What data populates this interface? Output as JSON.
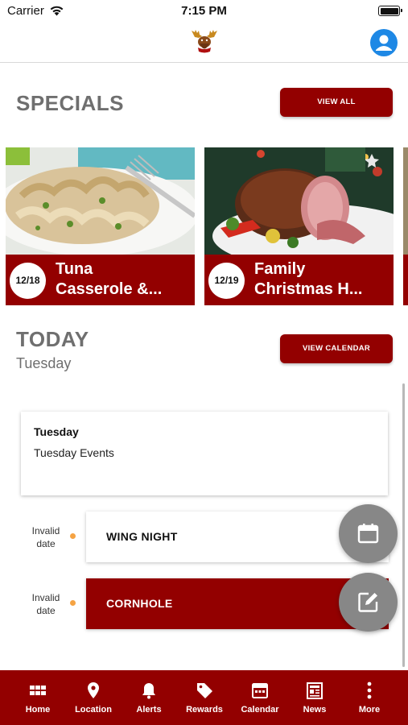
{
  "status_bar": {
    "carrier": "Carrier",
    "time": "7:15 PM"
  },
  "specials": {
    "heading": "SPECIALS",
    "view_all_label": "VIEW ALL",
    "items": [
      {
        "date": "12/18",
        "title_line1": "Tuna",
        "title_line2": "Casserole &..."
      },
      {
        "date": "12/19",
        "title_line1": "Family",
        "title_line2": "Christmas H..."
      }
    ]
  },
  "today": {
    "heading": "TODAY",
    "day": "Tuesday",
    "view_calendar_label": "VIEW CALENDAR",
    "card": {
      "day": "Tuesday",
      "text": "Tuesday Events"
    },
    "events": [
      {
        "date_line1": "Invalid",
        "date_line2": "date",
        "name": "WING NIGHT"
      },
      {
        "date_line1": "Invalid",
        "date_line2": "date",
        "name": "CORNHOLE"
      }
    ]
  },
  "tab_bar": {
    "items": [
      {
        "label": "Home",
        "icon": "grid-icon"
      },
      {
        "label": "Location",
        "icon": "map-pin-icon"
      },
      {
        "label": "Alerts",
        "icon": "bell-icon"
      },
      {
        "label": "Rewards",
        "icon": "tag-icon"
      },
      {
        "label": "Calendar",
        "icon": "calendar-icon"
      },
      {
        "label": "News",
        "icon": "newspaper-icon"
      },
      {
        "label": "More",
        "icon": "more-vertical-icon"
      }
    ]
  },
  "colors": {
    "brand": "#930000",
    "fab": "#878787",
    "profile": "#1e88e5",
    "event_dot": "#f5a343"
  }
}
